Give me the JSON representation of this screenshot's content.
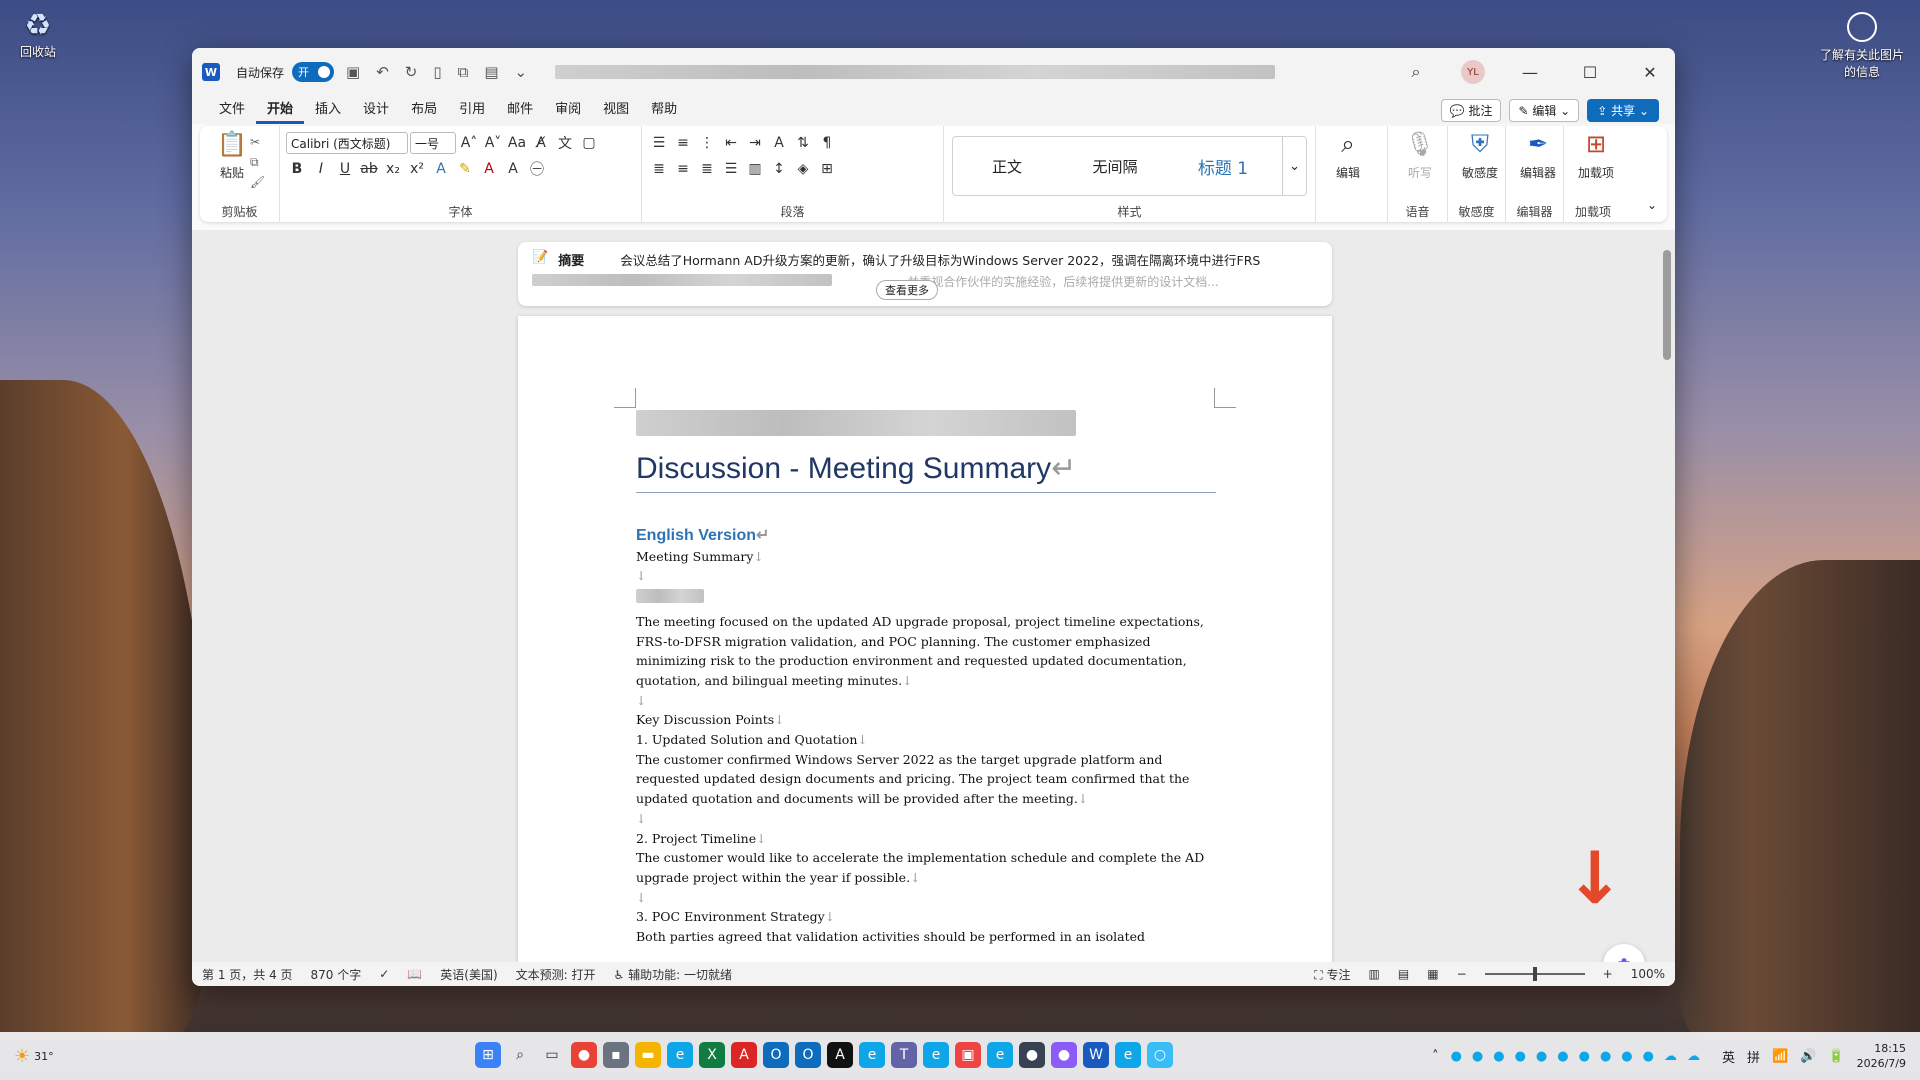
{
  "desktop": {
    "recycle_bin": "回收站",
    "info_icon_label": "了解有关此图片的信息"
  },
  "titlebar": {
    "autosave_label": "自动保存",
    "autosave_state": "开",
    "avatar": "YL"
  },
  "menu": {
    "items": [
      "文件",
      "开始",
      "插入",
      "设计",
      "布局",
      "引用",
      "邮件",
      "审阅",
      "视图",
      "帮助"
    ],
    "active": "开始",
    "comment": "批注",
    "edit": "编辑",
    "share": "共享"
  },
  "ribbon": {
    "clipboard": {
      "paste": "粘贴",
      "label": "剪贴板"
    },
    "font": {
      "name": "Calibri (西文标题)",
      "size": "一号",
      "label": "字体"
    },
    "paragraph": {
      "label": "段落"
    },
    "styles": {
      "items": [
        "正文",
        "无间隔",
        "标题 1"
      ],
      "label": "样式"
    },
    "editing": {
      "label": "编辑"
    },
    "voice": {
      "btn": "听写",
      "label": "语音"
    },
    "sensitivity": {
      "btn": "敏感度",
      "label": "敏感度"
    },
    "editor": {
      "btn": "编辑器",
      "label": "编辑器"
    },
    "addins": {
      "btn": "加载项",
      "label": "加载项"
    }
  },
  "summary": {
    "title": "摘要",
    "text": "会议总结了Hormann AD升级方案的更新，确认了升级目标为Windows Server 2022，强调在隔离环境中进行FRS",
    "text2": "...并重视合作伙伴的实施经验，后续将提供更新的设计文档...",
    "see_more": "查看更多"
  },
  "doc": {
    "title": "Discussion - Meeting Summary",
    "heading": "English Version",
    "p_meeting": "Meeting Summary",
    "p1": "The meeting focused on the updated AD upgrade proposal, project timeline expectations, FRS-to-DFSR migration validation, and POC planning. The customer emphasized minimizing risk to the production environment and requested updated documentation, quotation, and bilingual meeting minutes.",
    "key": "Key Discussion Points",
    "k1": "1. Updated Solution and Quotation",
    "p2": "The customer confirmed Windows Server 2022 as the target upgrade platform and requested updated design documents and pricing. The project team confirmed that the updated quotation and documents will be provided after the meeting.",
    "k2": "2. Project Timeline",
    "p3": "The customer would like to accelerate the implementation schedule and complete the AD upgrade project within the year if possible.",
    "k3": "3. POC Environment Strategy",
    "p4": "Both parties agreed that validation activities should be performed in an isolated"
  },
  "status": {
    "page": "第 1 页，共 4 页",
    "words": "870 个字",
    "lang": "英语(美国)",
    "predict": "文本预测: 打开",
    "access": "辅助功能: 一切就绪",
    "focus": "专注",
    "zoom": "100%"
  },
  "taskbar": {
    "weather": "31°",
    "ime1": "英",
    "ime2": "拼",
    "time": "18:15",
    "date": "2026/7/9"
  }
}
